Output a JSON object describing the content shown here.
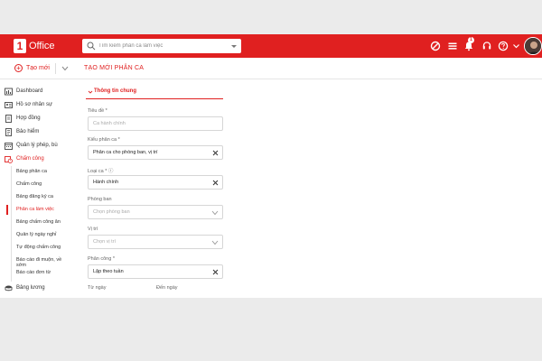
{
  "app": {
    "logo_mark": "1",
    "logo_text": "Office"
  },
  "search": {
    "placeholder": "Tìm kiếm phân ca làm việc"
  },
  "topbar": {
    "notification_count": "1"
  },
  "subheader": {
    "add_new_label": "Tạo mới",
    "page_title": "TẠO MỚI PHÂN CA"
  },
  "sidebar": {
    "items": [
      {
        "label": "Dashboard",
        "icon": "dashboard-icon"
      },
      {
        "label": "Hồ sơ nhân sự",
        "icon": "id-card-icon"
      },
      {
        "label": "Hợp đồng",
        "icon": "document-icon"
      },
      {
        "label": "Bảo hiểm",
        "icon": "insurance-icon"
      },
      {
        "label": "Quản lý phép, bù",
        "icon": "calendar-icon"
      },
      {
        "label": "Chấm công",
        "icon": "clock-calendar-icon"
      }
    ],
    "sub_items": [
      {
        "label": "Bảng phân ca"
      },
      {
        "label": "Chấm công"
      },
      {
        "label": "Bảng đăng ký ca"
      },
      {
        "label": "Phân ca làm việc"
      },
      {
        "label": "Bảng chấm công ăn"
      },
      {
        "label": "Quản lý ngày nghỉ"
      },
      {
        "label": "Tự động chấm công"
      },
      {
        "label": "Báo cáo đi muộn, về sớm"
      },
      {
        "label": "Báo cáo đơn từ"
      }
    ],
    "last_item": {
      "label": "Bảng lương",
      "icon": "money-icon"
    }
  },
  "form": {
    "section_title": "Thông tin chung",
    "fields": [
      {
        "label": "Tiêu đề *",
        "value": "",
        "placeholder": "Ca hành chính",
        "control": "text"
      },
      {
        "label": "Kiểu phân ca *",
        "value": "Phân ca cho phòng ban, vị trí",
        "placeholder": "",
        "control": "clear"
      },
      {
        "label": "Loại ca * ⓘ",
        "value": "Hành chính",
        "placeholder": "",
        "control": "clear"
      },
      {
        "label": "Phòng ban",
        "value": "",
        "placeholder": "Chọn phòng ban",
        "control": "dropdown"
      },
      {
        "label": "Vị trí",
        "value": "",
        "placeholder": "Chọn vị trí",
        "control": "dropdown"
      },
      {
        "label": "Phân công *",
        "value": "Lặp theo tuần",
        "placeholder": "",
        "control": "clear"
      }
    ],
    "from_date_label": "Từ ngày",
    "to_date_label": "Đến ngày"
  },
  "colors": {
    "brand": "#e02020",
    "background": "#ebebeb"
  }
}
